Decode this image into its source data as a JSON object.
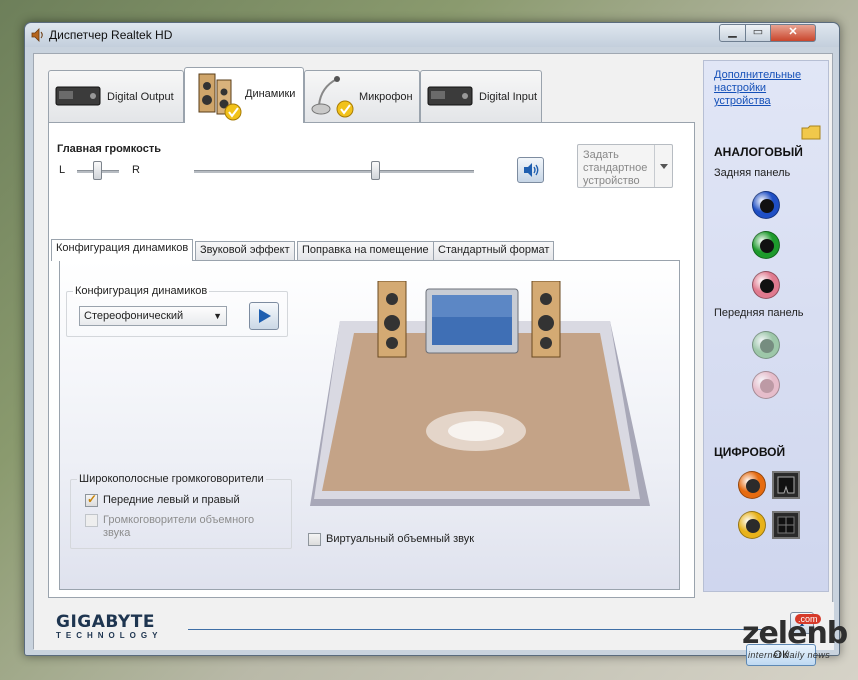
{
  "window": {
    "title": "Диспетчер Realtek HD"
  },
  "tabs": [
    {
      "label": "Digital Output",
      "icon": "digital-output-device-icon"
    },
    {
      "label": "Динамики",
      "icon": "speakers-icon"
    },
    {
      "label": "Микрофон",
      "icon": "microphone-icon"
    },
    {
      "label": "Digital Input",
      "icon": "digital-input-device-icon"
    }
  ],
  "volume": {
    "title": "Главная громкость",
    "left_label": "L",
    "right_label": "R",
    "balance_level": 0.5,
    "volume_level": 0.65,
    "set_default_label": "Задать стандартное устройство"
  },
  "sub_tabs": [
    {
      "label": "Конфигурация динамиков"
    },
    {
      "label": "Звуковой эффект"
    },
    {
      "label": "Поправка на помещение"
    },
    {
      "label": "Стандартный формат"
    }
  ],
  "speaker_config": {
    "group_title": "Конфигурация динамиков",
    "selected": "Стереофонический"
  },
  "wideband": {
    "group_title": "Широкополосные громкоговорители",
    "front_lr": {
      "label": "Передние левый и правый",
      "checked": true
    },
    "surround": {
      "label": "Громкоговорители объемного звука",
      "checked": false,
      "disabled": true
    }
  },
  "virtual_surround": {
    "label": "Виртуальный объемный звук",
    "checked": false
  },
  "right_panel": {
    "advanced_link": "Дополнительные настройки устройства",
    "analog_title": "АНАЛОГОВЫЙ",
    "rear_panel": "Задняя панель",
    "front_panel": "Передняя панель",
    "digital_title": "ЦИФРОВОЙ",
    "jack_colors": {
      "rear_blue": "#1f4fc4",
      "rear_green": "#1d9a2c",
      "rear_pink": "#e07a8f",
      "front_green": "#8fc298",
      "front_pink": "#ebb6c2",
      "digital_orange": "#e66b10",
      "digital_yellow": "#e8b21a"
    }
  },
  "footer": {
    "brand": "GIGABYTE",
    "brand_sub": "TECHNOLOGY",
    "ok_label": "ОК"
  },
  "watermark": {
    "name": "zelenb",
    "com": ".com",
    "tagline": "internet daily news"
  },
  "colors": {
    "accent_blue": "#1f5fb0",
    "floor": "#c4a387"
  }
}
